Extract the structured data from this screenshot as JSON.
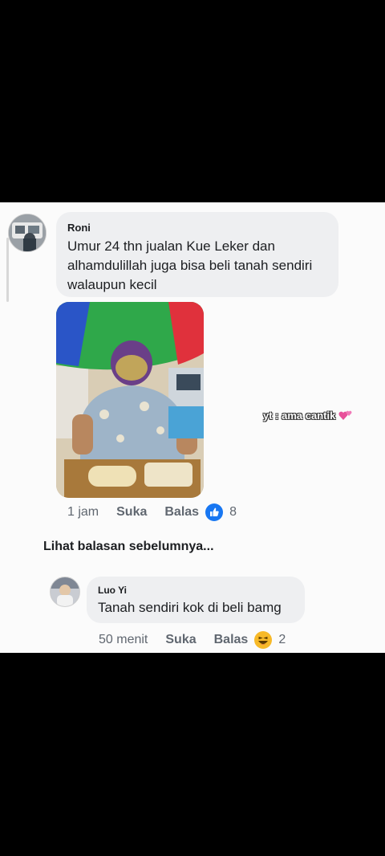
{
  "watermark": {
    "text": "yt : ama cantik",
    "icon": "two-hearts-icon"
  },
  "comment": {
    "author": "Roni",
    "text": "Umur 24 thn jualan Kue Leker dan alhamdulillah juga bisa beli tanah sendiri walaupun kecil",
    "time": "1 jam",
    "like_label": "Suka",
    "reply_label": "Balas",
    "reaction_icon": "like-icon",
    "reaction_count": "8"
  },
  "see_previous": "Lihat balasan sebelumnya...",
  "reply": {
    "author": "Luo Yi",
    "text": "Tanah sendiri kok di beli bamg",
    "time": "50 menit",
    "like_label": "Suka",
    "reply_label": "Balas",
    "reaction_icon": "haha-icon",
    "reaction_count": "2"
  },
  "colors": {
    "like_blue": "#1877f2",
    "haha_yellow": "#f7b928",
    "bubble_bg": "#eeeff1"
  }
}
